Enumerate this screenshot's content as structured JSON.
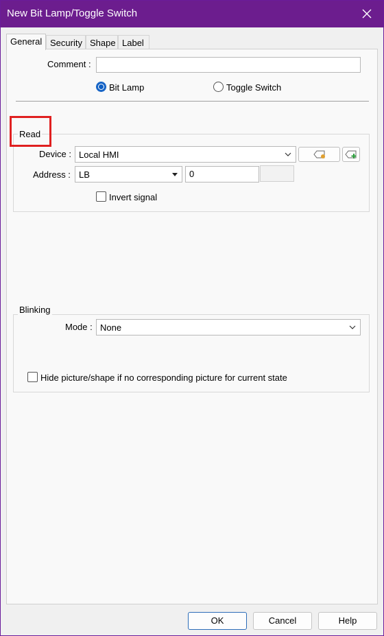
{
  "window": {
    "title": "New Bit Lamp/Toggle Switch"
  },
  "tabs": [
    {
      "label": "General"
    },
    {
      "label": "Security"
    },
    {
      "label": "Shape"
    },
    {
      "label": "Label"
    }
  ],
  "comment": {
    "label": "Comment :",
    "value": ""
  },
  "mode_select": {
    "bit_lamp": "Bit Lamp",
    "toggle_switch": "Toggle Switch",
    "selected": "Bit Lamp"
  },
  "read": {
    "title": "Read",
    "device_label": "Device :",
    "device_value": "Local HMI",
    "address_label": "Address :",
    "address_type": "LB",
    "address_value": "0",
    "invert_label": "Invert signal",
    "invert_checked": false
  },
  "blinking": {
    "title": "Blinking",
    "mode_label": "Mode :",
    "mode_value": "None",
    "hide_label": "Hide picture/shape if no corresponding picture for current state",
    "hide_checked": false
  },
  "buttons": {
    "ok": "OK",
    "cancel": "Cancel",
    "help": "Help"
  },
  "colors": {
    "titlebar": "#6c1d8e",
    "accent": "#0f5fc4",
    "highlight": "#e02020"
  }
}
